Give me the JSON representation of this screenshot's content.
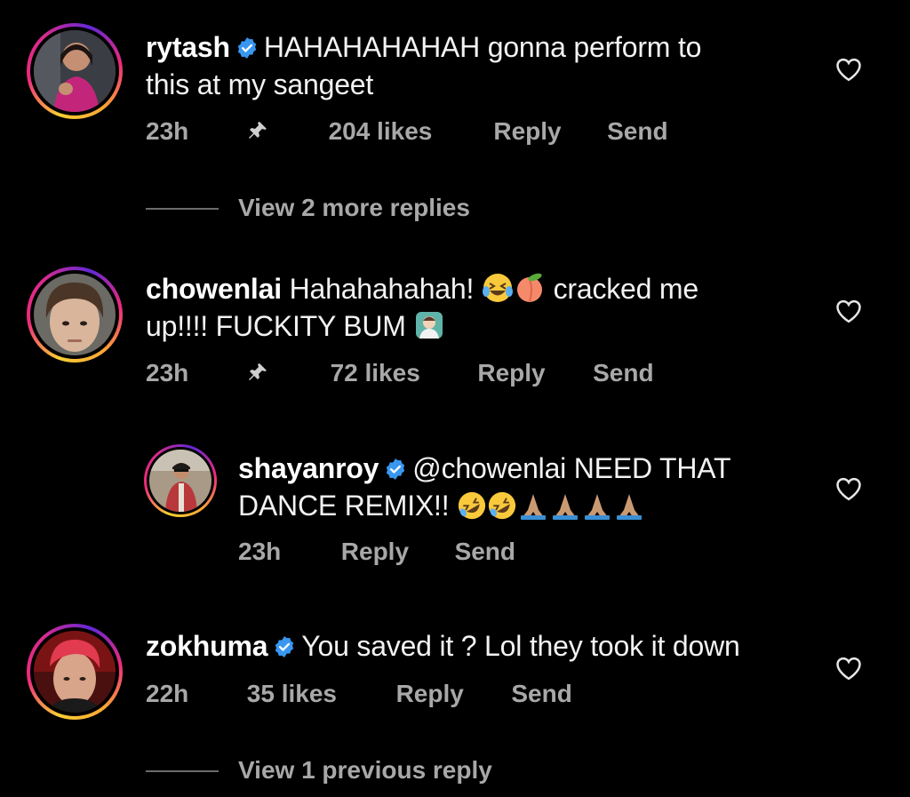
{
  "comments": [
    {
      "username": "rytash",
      "verified": true,
      "text_line1": "HAHAHAHAHAH gonna perform to",
      "text_line2": "this at my sangeet",
      "time": "23h",
      "pinned": true,
      "likes": "204 likes",
      "reply": "Reply",
      "send": "Send",
      "avatar_icon": "avatar-rytash"
    },
    {
      "username": "chowenlai",
      "verified": false,
      "text_line1_a": "Hahahahahah!",
      "text_line1_b": "cracked me",
      "text_line2": "up!!!! FUCKITY BUM",
      "time": "23h",
      "pinned": true,
      "likes": "72 likes",
      "reply": "Reply",
      "send": "Send",
      "avatar_icon": "avatar-chowenlai"
    },
    {
      "username": "shayanroy",
      "verified": true,
      "text_line1": "@chowenlai NEED THAT",
      "text_line2": "DANCE REMIX!!",
      "time": "23h",
      "reply": "Reply",
      "send": "Send",
      "avatar_icon": "avatar-shayanroy"
    },
    {
      "username": "zokhuma",
      "verified": true,
      "text_line1": "You saved it ? Lol they took it down",
      "time": "22h",
      "likes": "35 likes",
      "reply": "Reply",
      "send": "Send",
      "avatar_icon": "avatar-zokhuma"
    }
  ],
  "view_more_replies_1": "View 2 more replies",
  "view_previous_reply": "View 1 previous reply",
  "colors": {
    "background": "#000000",
    "text": "#f2f2f2",
    "meta": "#a8a8a8",
    "verified": "#3897f0"
  }
}
